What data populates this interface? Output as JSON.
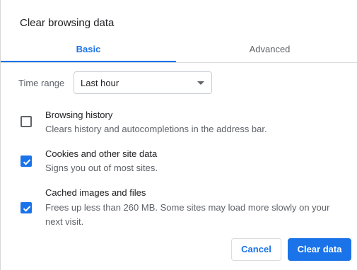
{
  "dialog": {
    "title": "Clear browsing data"
  },
  "tabs": [
    {
      "label": "Basic",
      "active": true
    },
    {
      "label": "Advanced",
      "active": false
    }
  ],
  "time_range": {
    "label": "Time range",
    "selected": "Last hour"
  },
  "items": [
    {
      "title": "Browsing history",
      "description": "Clears history and autocompletions in the address bar.",
      "checked": false
    },
    {
      "title": "Cookies and other site data",
      "description": "Signs you out of most sites.",
      "checked": true
    },
    {
      "title": "Cached images and files",
      "description": "Frees up less than 260 MB. Some sites may load more slowly on your next visit.",
      "checked": true
    }
  ],
  "buttons": {
    "cancel": "Cancel",
    "clear": "Clear data"
  },
  "colors": {
    "accent": "#1a73e8",
    "text_primary": "#202124",
    "text_secondary": "#5f6368",
    "divider": "#dadce0"
  }
}
